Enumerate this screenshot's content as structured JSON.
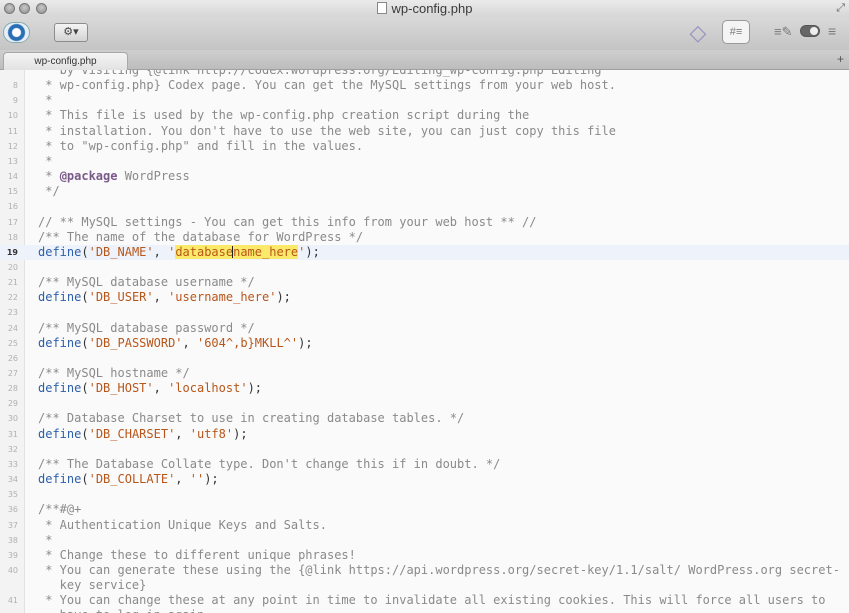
{
  "window": {
    "title": "wp-config.php"
  },
  "tabs": [
    {
      "label": "wp-config.php"
    }
  ],
  "toolbar": {
    "gear_symbol": "⚙▾"
  },
  "code_lines": [
    {
      "n": "",
      "segs": [
        {
          "t": "c",
          "v": "   by visiting {@link http://codex.wordpress.org/Editing_wp-config.php Editing"
        }
      ]
    },
    {
      "n": "8",
      "segs": [
        {
          "t": "c",
          "v": " * wp-config.php} Codex page. You can get the MySQL settings from your web host."
        }
      ]
    },
    {
      "n": "9",
      "segs": [
        {
          "t": "c",
          "v": " *"
        }
      ]
    },
    {
      "n": "10",
      "segs": [
        {
          "t": "c",
          "v": " * This file is used by the wp-config.php creation script during the"
        }
      ]
    },
    {
      "n": "11",
      "segs": [
        {
          "t": "c",
          "v": " * installation. You don't have to use the web site, you can just copy this file"
        }
      ]
    },
    {
      "n": "12",
      "segs": [
        {
          "t": "c",
          "v": " * to \"wp-config.php\" and fill in the values."
        }
      ]
    },
    {
      "n": "13",
      "segs": [
        {
          "t": "c",
          "v": " *"
        }
      ]
    },
    {
      "n": "14",
      "segs": [
        {
          "t": "c",
          "v": " * "
        },
        {
          "t": "doc",
          "v": "@package"
        },
        {
          "t": "c",
          "v": " WordPress"
        }
      ]
    },
    {
      "n": "15",
      "segs": [
        {
          "t": "c",
          "v": " */"
        }
      ]
    },
    {
      "n": "16",
      "segs": []
    },
    {
      "n": "17",
      "segs": [
        {
          "t": "c",
          "v": "// ** MySQL settings - You can get this info from your web host ** //"
        }
      ]
    },
    {
      "n": "18",
      "segs": [
        {
          "t": "c",
          "v": "/** The name of the database for WordPress */"
        }
      ]
    },
    {
      "n": "19",
      "current": true,
      "segs": [
        {
          "t": "kw",
          "v": "define"
        },
        {
          "t": "p",
          "v": "("
        },
        {
          "t": "str",
          "v": "'DB_NAME'"
        },
        {
          "t": "p",
          "v": ", "
        },
        {
          "t": "str",
          "v": "'"
        },
        {
          "t": "str-hl",
          "v": "database"
        },
        {
          "t": "cursor",
          "v": ""
        },
        {
          "t": "str-hl",
          "v": "name_here"
        },
        {
          "t": "str",
          "v": "'"
        },
        {
          "t": "p",
          "v": ");"
        }
      ]
    },
    {
      "n": "20",
      "segs": []
    },
    {
      "n": "21",
      "segs": [
        {
          "t": "c",
          "v": "/** MySQL database username */"
        }
      ]
    },
    {
      "n": "22",
      "segs": [
        {
          "t": "kw",
          "v": "define"
        },
        {
          "t": "p",
          "v": "("
        },
        {
          "t": "str",
          "v": "'DB_USER'"
        },
        {
          "t": "p",
          "v": ", "
        },
        {
          "t": "str",
          "v": "'username_here'"
        },
        {
          "t": "p",
          "v": ");"
        }
      ]
    },
    {
      "n": "23",
      "segs": []
    },
    {
      "n": "24",
      "segs": [
        {
          "t": "c",
          "v": "/** MySQL database password */"
        }
      ]
    },
    {
      "n": "25",
      "segs": [
        {
          "t": "kw",
          "v": "define"
        },
        {
          "t": "p",
          "v": "("
        },
        {
          "t": "str",
          "v": "'DB_PASSWORD'"
        },
        {
          "t": "p",
          "v": ", "
        },
        {
          "t": "str",
          "v": "'604^,b}MKLL^'"
        },
        {
          "t": "p",
          "v": ");"
        }
      ]
    },
    {
      "n": "26",
      "segs": []
    },
    {
      "n": "27",
      "segs": [
        {
          "t": "c",
          "v": "/** MySQL hostname */"
        }
      ]
    },
    {
      "n": "28",
      "segs": [
        {
          "t": "kw",
          "v": "define"
        },
        {
          "t": "p",
          "v": "("
        },
        {
          "t": "str",
          "v": "'DB_HOST'"
        },
        {
          "t": "p",
          "v": ", "
        },
        {
          "t": "str",
          "v": "'localhost'"
        },
        {
          "t": "p",
          "v": ");"
        }
      ]
    },
    {
      "n": "29",
      "segs": []
    },
    {
      "n": "30",
      "segs": [
        {
          "t": "c",
          "v": "/** Database Charset to use in creating database tables. */"
        }
      ]
    },
    {
      "n": "31",
      "segs": [
        {
          "t": "kw",
          "v": "define"
        },
        {
          "t": "p",
          "v": "("
        },
        {
          "t": "str",
          "v": "'DB_CHARSET'"
        },
        {
          "t": "p",
          "v": ", "
        },
        {
          "t": "str",
          "v": "'utf8'"
        },
        {
          "t": "p",
          "v": ");"
        }
      ]
    },
    {
      "n": "32",
      "segs": []
    },
    {
      "n": "33",
      "segs": [
        {
          "t": "c",
          "v": "/** The Database Collate type. Don't change this if in doubt. */"
        }
      ]
    },
    {
      "n": "34",
      "segs": [
        {
          "t": "kw",
          "v": "define"
        },
        {
          "t": "p",
          "v": "("
        },
        {
          "t": "str",
          "v": "'DB_COLLATE'"
        },
        {
          "t": "p",
          "v": ", "
        },
        {
          "t": "str",
          "v": "''"
        },
        {
          "t": "p",
          "v": ");"
        }
      ]
    },
    {
      "n": "35",
      "segs": []
    },
    {
      "n": "36",
      "segs": [
        {
          "t": "c",
          "v": "/**#@+"
        }
      ]
    },
    {
      "n": "37",
      "segs": [
        {
          "t": "c",
          "v": " * Authentication Unique Keys and Salts."
        }
      ]
    },
    {
      "n": "38",
      "segs": [
        {
          "t": "c",
          "v": " *"
        }
      ]
    },
    {
      "n": "39",
      "segs": [
        {
          "t": "c",
          "v": " * Change these to different unique phrases!"
        }
      ]
    },
    {
      "n": "40",
      "segs": [
        {
          "t": "c",
          "v": " * You can generate these using the {@link https://api.wordpress.org/secret-key/1.1/salt/ WordPress.org secret-"
        }
      ]
    },
    {
      "n": "",
      "segs": [
        {
          "t": "c",
          "v": "   key service}"
        }
      ]
    },
    {
      "n": "41",
      "segs": [
        {
          "t": "c",
          "v": " * You can change these at any point in time to invalidate all existing cookies. This will force all users to"
        }
      ]
    },
    {
      "n": "",
      "segs": [
        {
          "t": "c",
          "v": "   have to log in again."
        }
      ]
    }
  ]
}
